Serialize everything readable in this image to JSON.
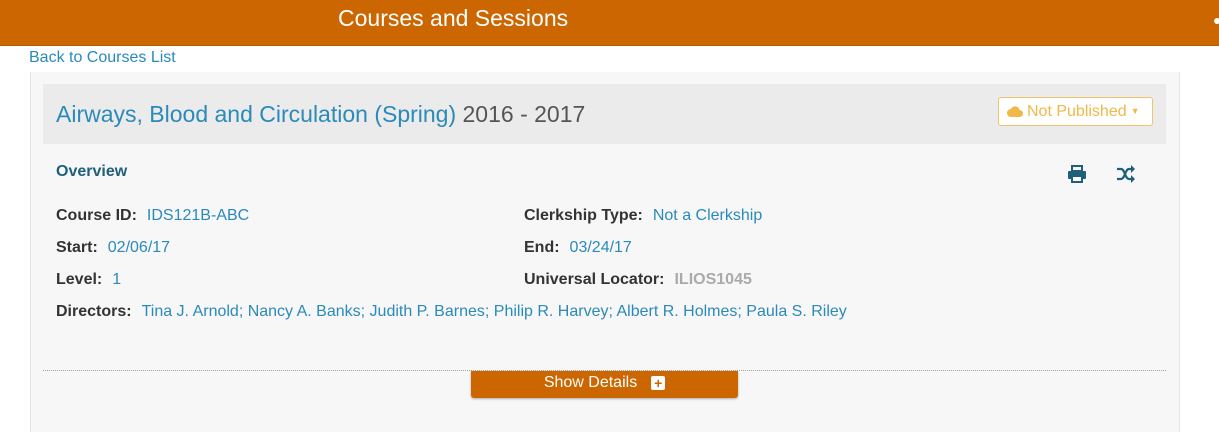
{
  "header": {
    "title": "Courses and Sessions"
  },
  "nav": {
    "back_link": "Back to Courses List"
  },
  "course": {
    "title": "Airways, Blood and Circulation (Spring)",
    "year": "2016 - 2017",
    "publish_status": "Not Published"
  },
  "overview": {
    "heading": "Overview",
    "course_id_label": "Course ID:",
    "course_id": "IDS121B-ABC",
    "clerkship_label": "Clerkship Type:",
    "clerkship": "Not a Clerkship",
    "start_label": "Start:",
    "start": "02/06/17",
    "end_label": "End:",
    "end": "03/24/17",
    "level_label": "Level:",
    "level": "1",
    "locator_label": "Universal Locator:",
    "locator": "ILIOS1045",
    "directors_label": "Directors:",
    "directors": "Tina J. Arnold; Nancy A. Banks; Judith P. Barnes; Philip R. Harvey; Albert R. Holmes; Paula S. Riley"
  },
  "actions": {
    "show_details": "Show Details"
  },
  "icons": {
    "print": "print-icon",
    "shuffle": "shuffle-icon",
    "cloud": "cloud-icon",
    "plus": "plus-icon"
  },
  "colors": {
    "brand": "#cc6600",
    "link": "#2a8ab9",
    "warning": "#f0b849"
  }
}
